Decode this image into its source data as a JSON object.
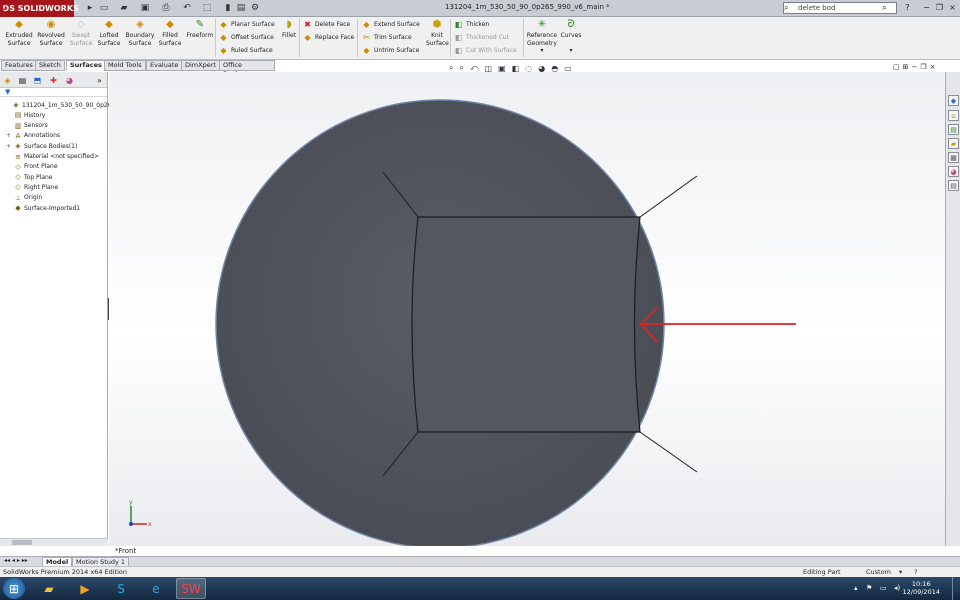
{
  "app": {
    "logo": "SOLIDWORKS",
    "title": "131204_1m_530_50_90_0p265_990_v6_main *"
  },
  "search": {
    "value": "delete bod"
  },
  "ribbon": {
    "large_buttons": [
      {
        "label1": "Extruded",
        "label2": "Surface",
        "icon": "extruded-surface-icon",
        "glyph": "◆"
      },
      {
        "label1": "Revolved",
        "label2": "Surface",
        "icon": "revolved-surface-icon",
        "glyph": "◉"
      },
      {
        "label1": "Swept",
        "label2": "Surface",
        "icon": "swept-surface-icon",
        "glyph": "◇",
        "disabled": true
      },
      {
        "label1": "Lofted",
        "label2": "Surface",
        "icon": "lofted-surface-icon",
        "glyph": "◆"
      },
      {
        "label1": "Boundary",
        "label2": "Surface",
        "icon": "boundary-surface-icon",
        "glyph": "◈"
      },
      {
        "label1": "Filled",
        "label2": "Surface",
        "icon": "filled-surface-icon",
        "glyph": "◆"
      },
      {
        "label1": "Freeform",
        "label2": "",
        "icon": "freeform-icon",
        "glyph": "✎"
      }
    ],
    "col1": [
      "Planar Surface",
      "Offset Surface",
      "Ruled Surface"
    ],
    "fillet": "Fillet",
    "col2": [
      "Delete Face",
      "Replace Face"
    ],
    "col3": [
      "Extend Surface",
      "Trim Surface",
      "Untrim Surface"
    ],
    "knit1": "Knit",
    "knit2": "Surface",
    "col4": [
      "Thicken",
      "Thickened Cut",
      "Cut With Surface"
    ],
    "ref1": "Reference",
    "ref2": "Geometry",
    "curves": "Curves"
  },
  "tabs": [
    "Features",
    "Sketch",
    "Surfaces",
    "Mold Tools",
    "Evaluate",
    "DimXpert",
    "Office Products"
  ],
  "tree": [
    {
      "label": "131204_1m_530_50_90_0p265_99",
      "icon": "part-icon",
      "glyph": "◈",
      "indent": 0
    },
    {
      "label": "History",
      "icon": "history-icon",
      "glyph": "▤",
      "indent": 1
    },
    {
      "label": "Sensors",
      "icon": "sensors-icon",
      "glyph": "▥",
      "indent": 1
    },
    {
      "label": "Annotations",
      "icon": "annotations-icon",
      "glyph": "A",
      "indent": 1,
      "expand": "+"
    },
    {
      "label": "Surface Bodies(1)",
      "icon": "surface-bodies-icon",
      "glyph": "◈",
      "indent": 1,
      "expand": "+"
    },
    {
      "label": "Material <not specified>",
      "icon": "material-icon",
      "glyph": "≡",
      "indent": 1
    },
    {
      "label": "Front Plane",
      "icon": "plane-icon",
      "glyph": "◇",
      "indent": 1
    },
    {
      "label": "Top Plane",
      "icon": "plane-icon",
      "glyph": "◇",
      "indent": 1
    },
    {
      "label": "Right Plane",
      "icon": "plane-icon",
      "glyph": "◇",
      "indent": 1
    },
    {
      "label": "Origin",
      "icon": "origin-icon",
      "glyph": "⊥",
      "indent": 1
    },
    {
      "label": "Surface-Imported1",
      "icon": "imported-surface-icon",
      "glyph": "◆",
      "indent": 1
    }
  ],
  "viewport": {
    "view_label": "*Front"
  },
  "bottom_tabs": [
    "Model",
    "Motion Study 1"
  ],
  "status": {
    "edition": "SolidWorks Premium 2014 x64 Edition",
    "mode": "Editing Part",
    "units": "Custom",
    "units_arrow": "▾",
    "help": "?"
  },
  "clock": {
    "time": "10:16",
    "date": "12/09/2014"
  },
  "colors": {
    "body": "#565961",
    "edge": "#1b1c20",
    "arrow": "#e02020",
    "outline": "#6f87a6"
  }
}
